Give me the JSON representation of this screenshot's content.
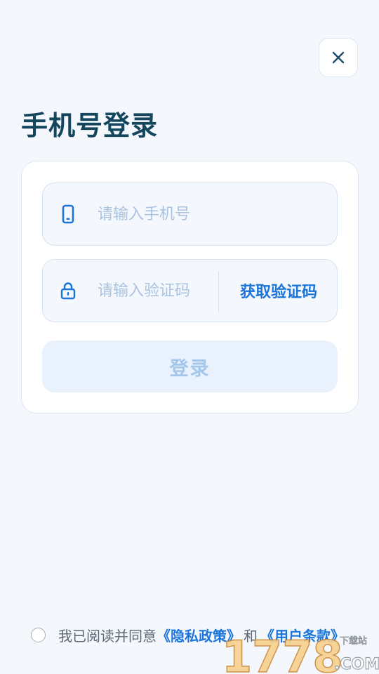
{
  "header": {
    "title": "手机号登录",
    "close_icon": "close-icon"
  },
  "form": {
    "phone": {
      "placeholder": "请输入手机号",
      "value": "",
      "icon": "phone-icon"
    },
    "code": {
      "placeholder": "请输入验证码",
      "value": "",
      "icon": "lock-icon"
    },
    "get_code_label": "获取验证码",
    "login_label": "登录"
  },
  "agreement": {
    "checked": false,
    "prefix": "我已阅读并同意",
    "privacy_link": "《隐私政策》",
    "conjunction": "和",
    "terms_link": "《用户条款》"
  },
  "watermark": {
    "number": "1778",
    "suffix": ".COM",
    "caption": "下载站"
  },
  "colors": {
    "background": "#f4f8fd",
    "title": "#14475e",
    "accent": "#1a74d9",
    "placeholder": "#a9c3e0",
    "button_disabled_bg": "#e9f2fc",
    "button_disabled_text": "#a3c6eb"
  }
}
